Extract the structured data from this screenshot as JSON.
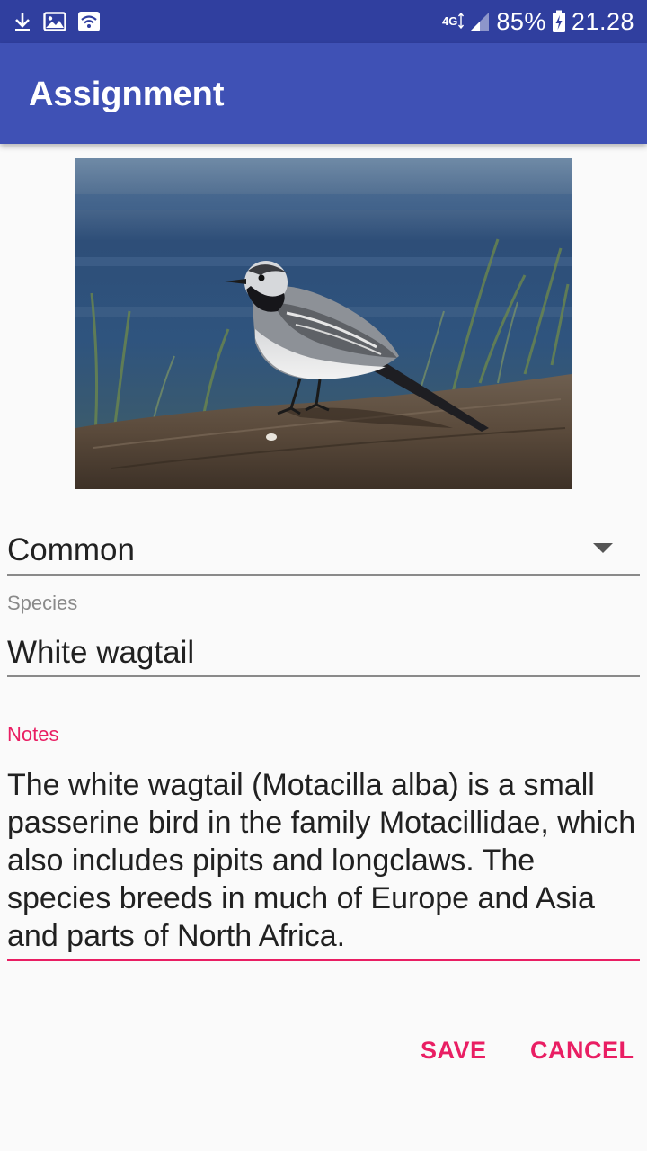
{
  "status_bar": {
    "network": "4G",
    "battery": "85%",
    "time": "21.28",
    "icons": [
      "download-icon",
      "image-icon",
      "wifi-icon",
      "signal-icon",
      "battery-charging-icon"
    ]
  },
  "app_bar": {
    "title": "Assignment"
  },
  "photo": {
    "subject": "white wagtail bird on a log"
  },
  "spinner": {
    "selected": "Common"
  },
  "species": {
    "label": "Species",
    "value": "White wagtail"
  },
  "notes": {
    "label": "Notes",
    "value": "The white wagtail (Motacilla alba) is a small passerine bird in the family Motacillidae, which also includes pipits and longclaws. The species breeds in much of Europe and Asia and parts of North Africa."
  },
  "actions": {
    "save": "SAVE",
    "cancel": "CANCEL"
  },
  "colors": {
    "status_bar": "#303f9f",
    "app_bar": "#3f51b5",
    "accent": "#e91e63"
  }
}
